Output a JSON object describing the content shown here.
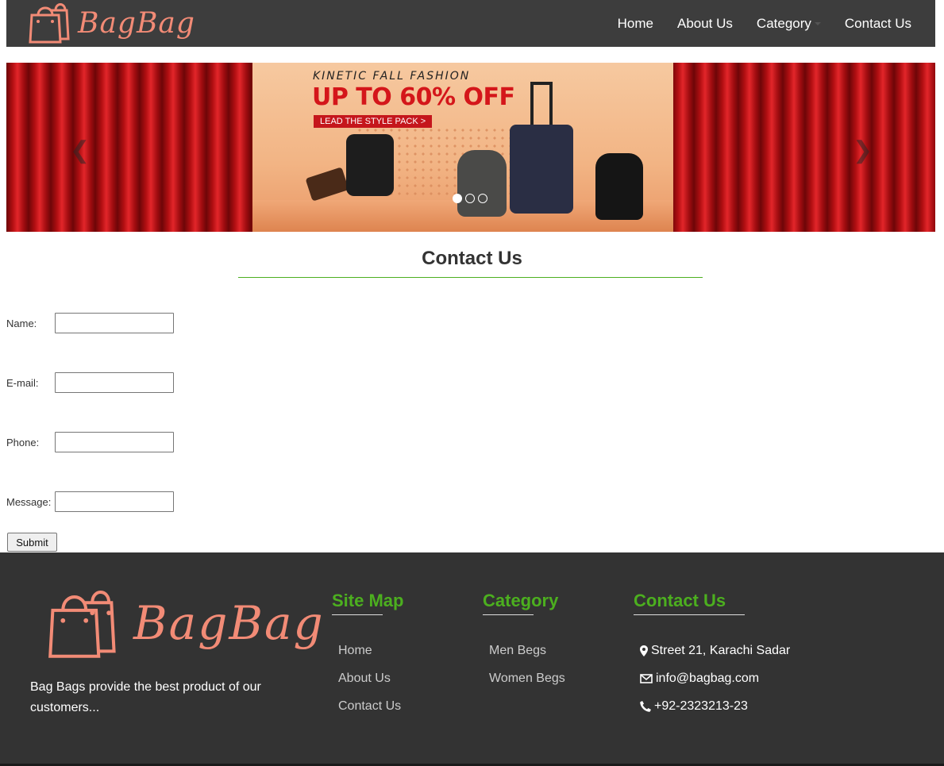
{
  "brand": {
    "name": "BagBag"
  },
  "nav": {
    "items": [
      {
        "label": "Home"
      },
      {
        "label": "About Us"
      },
      {
        "label": "Category"
      },
      {
        "label": "Contact Us"
      }
    ]
  },
  "banner": {
    "subtitle": "KINETIC FALL FASHION",
    "headline": "UP TO 60% OFF",
    "cta": "LEAD THE STYLE PACK >",
    "prev_icon": "chevron-left-icon",
    "next_icon": "chevron-right-icon",
    "slide_count": 3,
    "active_slide": 1
  },
  "contact_section": {
    "title": "Contact Us",
    "fields": [
      {
        "label": "Name:",
        "value": ""
      },
      {
        "label": "E-mail:",
        "value": ""
      },
      {
        "label": "Phone:",
        "value": ""
      },
      {
        "label": "Message:",
        "value": ""
      }
    ],
    "submit_label": "Submit"
  },
  "footer": {
    "brand": "BagBag",
    "description": "Bag Bags provide the best product of our customers...",
    "site_map": {
      "heading": "Site Map",
      "links": [
        "Home",
        "About Us",
        "Contact Us"
      ]
    },
    "category": {
      "heading": "Category",
      "links": [
        "Men Begs",
        "Women Begs"
      ]
    },
    "contact": {
      "heading": "Contact Us",
      "address": "Street 21, Karachi Sadar",
      "email": "info@bagbag.com",
      "phone": "+92-2323213-23"
    }
  },
  "colors": {
    "navbar_bg": "#3d3d3d",
    "brand": "#f28b76",
    "accent_green": "#4caf1f",
    "footer_bg": "#333333"
  }
}
